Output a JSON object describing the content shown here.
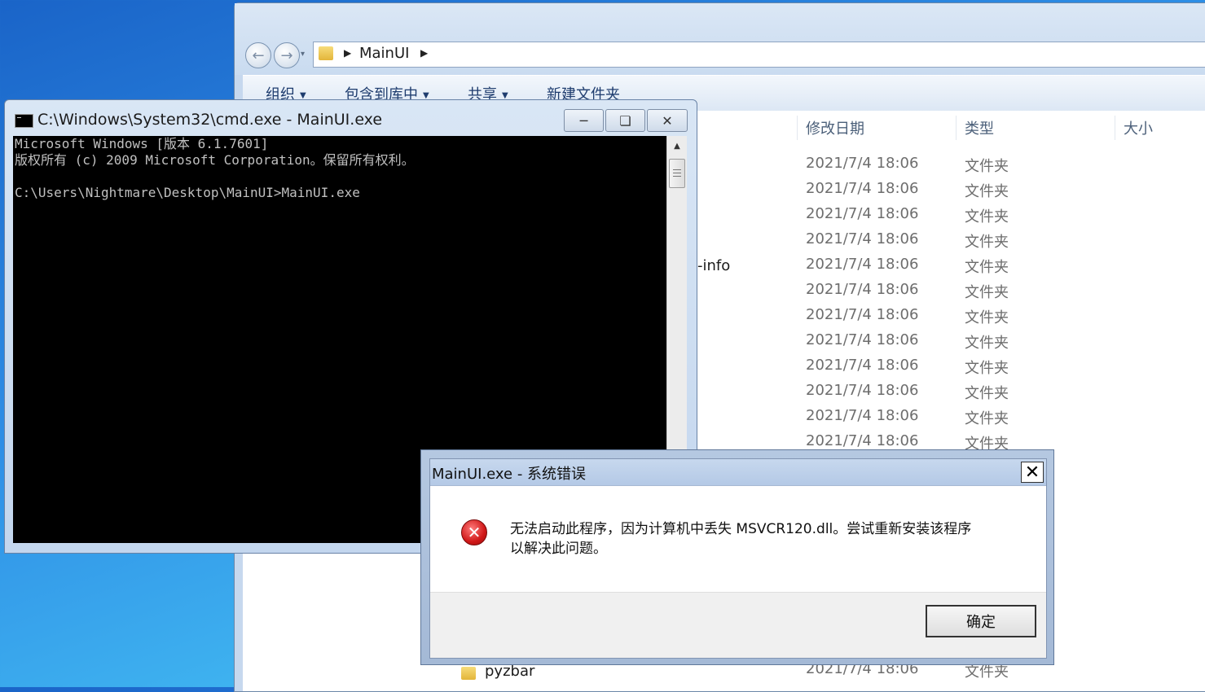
{
  "explorer": {
    "address": "MainUI",
    "toolbar": {
      "organize": "组织",
      "include_library": "包含到库中",
      "share": "共享",
      "new_folder": "新建文件夹"
    },
    "columns": {
      "date": "修改日期",
      "type": "类型",
      "size": "大小"
    },
    "rows": [
      {
        "date": "2021/7/4 18:06",
        "type": "文件夹"
      },
      {
        "date": "2021/7/4 18:06",
        "type": "文件夹"
      },
      {
        "date": "2021/7/4 18:06",
        "type": "文件夹"
      },
      {
        "date": "2021/7/4 18:06",
        "type": "文件夹"
      },
      {
        "date": "2021/7/4 18:06",
        "type": "文件夹"
      },
      {
        "date": "2021/7/4 18:06",
        "type": "文件夹"
      },
      {
        "date": "2021/7/4 18:06",
        "type": "文件夹"
      },
      {
        "date": "2021/7/4 18:06",
        "type": "文件夹"
      },
      {
        "date": "2021/7/4 18:06",
        "type": "文件夹"
      },
      {
        "date": "2021/7/4 18:06",
        "type": "文件夹"
      },
      {
        "date": "2021/7/4 18:06",
        "type": "文件夹"
      },
      {
        "date": "2021/7/4 18:06",
        "type": "文件夹"
      }
    ],
    "partial_name": "-info",
    "last_row": {
      "name": "pyzbar",
      "date": "2021/7/4 18:06",
      "type": "文件夹"
    }
  },
  "cmd": {
    "title": "C:\\Windows\\System32\\cmd.exe - MainUI.exe",
    "lines": [
      "Microsoft Windows [版本 6.1.7601]",
      "版权所有 (c) 2009 Microsoft Corporation。保留所有权利。",
      "",
      "C:\\Users\\Nightmare\\Desktop\\MainUI>MainUI.exe"
    ]
  },
  "dialog": {
    "title": "MainUI.exe - 系统错误",
    "message_line1": "无法启动此程序，因为计算机中丢失 MSVCR120.dll。尝试重新安装该程序",
    "message_line2": "以解决此问题。",
    "ok_label": "确定"
  },
  "icons": {
    "back": "back-arrow-icon",
    "forward": "forward-arrow-icon",
    "folder": "folder-icon",
    "error": "error-icon",
    "close": "close-icon"
  },
  "colors": {
    "desktop": "#2f8fe6",
    "console_bg": "#000000",
    "console_text": "#c0c0c0",
    "error_red": "#d01818"
  }
}
